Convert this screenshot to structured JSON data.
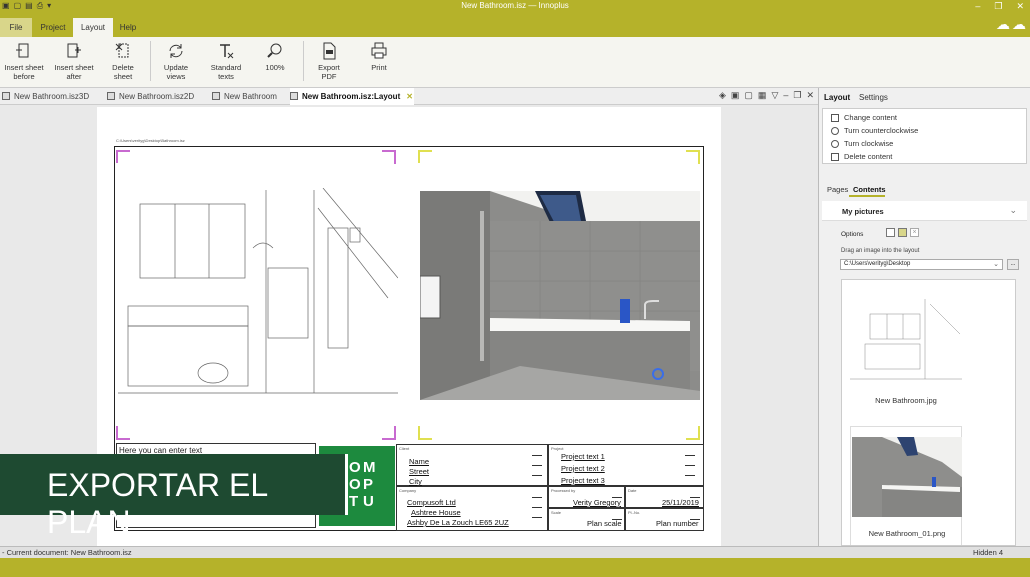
{
  "window": {
    "title": "New Bathroom.isz — Innoplus"
  },
  "menu": {
    "tabs": [
      "File",
      "Project",
      "Layout",
      "Help"
    ],
    "active": "Layout"
  },
  "ribbon": {
    "buttons": [
      {
        "label1": "Insert sheet",
        "label2": "before"
      },
      {
        "label1": "Insert sheet",
        "label2": "after"
      },
      {
        "label1": "Delete",
        "label2": "sheet"
      },
      {
        "label1": "Update",
        "label2": "views"
      },
      {
        "label1": "Standard",
        "label2": "texts"
      },
      {
        "label1": "100%",
        "label2": ""
      },
      {
        "label1": "Export",
        "label2": "PDF"
      },
      {
        "label1": "Print",
        "label2": ""
      }
    ]
  },
  "doc_tabs": [
    "New Bathroom.isz3D",
    "New Bathroom.isz2D",
    "New Bathroom",
    "New Bathroom.isz:Layout"
  ],
  "sheet": {
    "path": "C:\\Users\\verityg\\Desktop\\Bathroom.isz",
    "text_box": "Here you can enter text",
    "logo_row1": [
      "M",
      "P",
      "U"
    ],
    "logo_row2": [
      "O",
      "O",
      "T"
    ],
    "client": {
      "label": "Client",
      "name": "Name",
      "street": "Street",
      "city": "City"
    },
    "project": {
      "label": "Project",
      "t1": "Project text 1",
      "t2": "Project text 2",
      "t3": "Project text 3"
    },
    "company": {
      "label": "Company",
      "l1": "Compusoft Ltd",
      "l2": "Ashtree House",
      "l3": "Ashby De La Zouch LE65 2UZ"
    },
    "processed": {
      "label": "Processed by",
      "value": "Verity Gregory"
    },
    "date": {
      "label": "Date",
      "value": "25/11/2019"
    },
    "scale": {
      "label": "Scale",
      "value": "Plan scale"
    },
    "planno": {
      "label": "Pl.-No.",
      "value": "Plan number"
    }
  },
  "overlay": {
    "text": "EXPORTAR EL PLAN"
  },
  "panel": {
    "tabs": [
      "Layout",
      "Settings"
    ],
    "context": [
      "Change content",
      "Turn counterclockwise",
      "Turn clockwise",
      "Delete content"
    ],
    "subtabs": [
      "Pages",
      "Contents"
    ],
    "section": "My pictures",
    "options_label": "Options",
    "drag_label": "Drag an image into the layout",
    "path": "C:\\Users\\verityg\\Desktop",
    "path_btn": "...",
    "thumbs": [
      "New Bathroom.jpg",
      "New Bathroom_01.png"
    ]
  },
  "status": {
    "left": "- Current document: New Bathroom.isz",
    "right": "Hidden 4"
  },
  "colors": {
    "accent": "#b5b22a",
    "logo": "#1d8a3e",
    "overlay": "#1e4a31",
    "corner_magenta": "#c86ad0",
    "corner_yellow": "#e0e050"
  }
}
